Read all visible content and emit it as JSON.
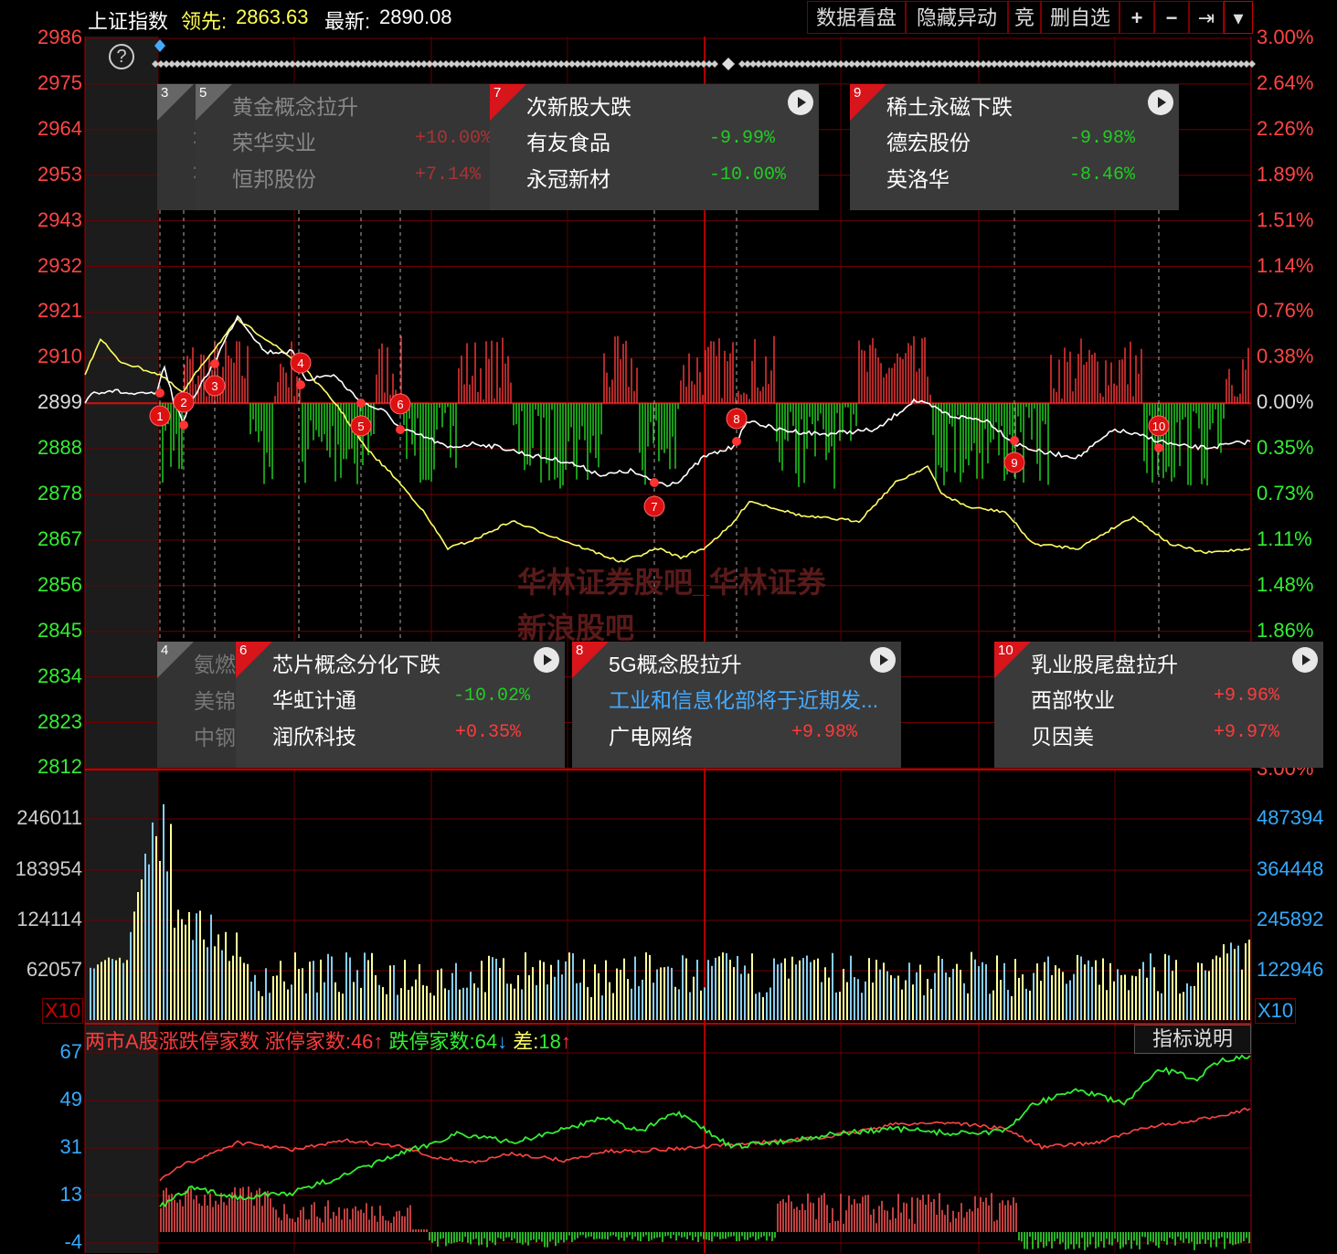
{
  "header": {
    "index_name": "上证指数",
    "lead_label": "领先:",
    "lead_value": "2863.63",
    "latest_label": "最新:",
    "latest_value": "2890.08",
    "toolbar": {
      "data_review": "数据看盘",
      "hide_anomaly": "隐藏异动",
      "bid": "竞",
      "delete_watch": "删自选",
      "zoom_in": "+",
      "zoom_out": "−",
      "to_end": "⇥",
      "menu": "▾"
    }
  },
  "help": {
    "icon": "question-icon",
    "glyph": "?"
  },
  "price_axis": {
    "left": [
      "2986",
      "2975",
      "2964",
      "2953",
      "2943",
      "2932",
      "2921",
      "2910",
      "2899",
      "2888",
      "2878",
      "2867",
      "2856",
      "2845",
      "2834",
      "2823",
      "2812"
    ],
    "right": [
      "3.00%",
      "2.64%",
      "2.26%",
      "1.89%",
      "1.51%",
      "1.14%",
      "0.76%",
      "0.38%",
      "0.00%",
      "0.35%",
      "0.73%",
      "1.11%",
      "1.48%",
      "1.86%"
    ],
    "right_bottom_partial": "3.00%"
  },
  "volume_axis": {
    "left": [
      "246011",
      "183954",
      "124114",
      "62057"
    ],
    "right": [
      "487394",
      "364448",
      "245892",
      "122946"
    ],
    "multiplier": "X10"
  },
  "breadth": {
    "title": "两市A股涨跌停家数",
    "limit_up_label": "涨停家数:",
    "limit_up_value": "46",
    "limit_down_label": "跌停家数:",
    "limit_down_value": "64",
    "diff_label": "差:",
    "diff_value": "18",
    "explain_button": "指标说明",
    "axis": [
      "67",
      "49",
      "31",
      "13",
      "-4"
    ]
  },
  "event_cards_top": [
    {
      "num": "3",
      "title": "",
      "rows": []
    },
    {
      "num": "5",
      "title": "黄金概念拉升",
      "rows": [
        {
          "name": "荣华实业",
          "pct": "+10.00%"
        },
        {
          "name": "恒邦股份",
          "pct": "+7.14%"
        }
      ]
    },
    {
      "num": "7",
      "title": "次新股大跌",
      "rows": [
        {
          "name": "有友食品",
          "pct": "-9.99%"
        },
        {
          "name": "永冠新材",
          "pct": "-10.00%"
        }
      ]
    },
    {
      "num": "9",
      "title": "稀土永磁下跌",
      "rows": [
        {
          "name": "德宏股份",
          "pct": "-9.98%"
        },
        {
          "name": "英洛华",
          "pct": "-8.46%"
        }
      ]
    }
  ],
  "event_cards_bottom": [
    {
      "num": "4",
      "title": "",
      "rows": [
        {
          "name": "氨燃"
        },
        {
          "name": "美锦"
        },
        {
          "name": "中钢"
        }
      ]
    },
    {
      "num": "6",
      "title": "芯片概念分化下跌",
      "rows": [
        {
          "name": "华虹计通",
          "pct": "-10.02%"
        },
        {
          "name": "润欣科技",
          "pct": "+0.35%"
        }
      ]
    },
    {
      "num": "8",
      "title": "5G概念股拉升",
      "rows": [
        {
          "name": "工业和信息化部将于近期发..."
        },
        {
          "name": "广电网络",
          "pct": "+9.98%"
        }
      ]
    },
    {
      "num": "10",
      "title": "乳业股尾盘拉升",
      "rows": [
        {
          "name": "西部牧业",
          "pct": "+9.96%"
        },
        {
          "name": "贝因美",
          "pct": "+9.97%"
        }
      ]
    }
  ],
  "markers": [
    "1",
    "2",
    "3",
    "4",
    "5",
    "6",
    "7",
    "8",
    "9",
    "10"
  ],
  "watermark": "华林证券股吧_华林证券新浪股吧",
  "colors": {
    "up": "#ff3a3a",
    "down": "#22dd22",
    "grid": "#8b0000",
    "price_line": "#ffffff",
    "avg_line": "#ffff66",
    "bar_yellow": "#ffff99",
    "bar_blue": "#88ccee",
    "axis_blue": "#33aaff",
    "highlight": "#00ffff"
  }
}
